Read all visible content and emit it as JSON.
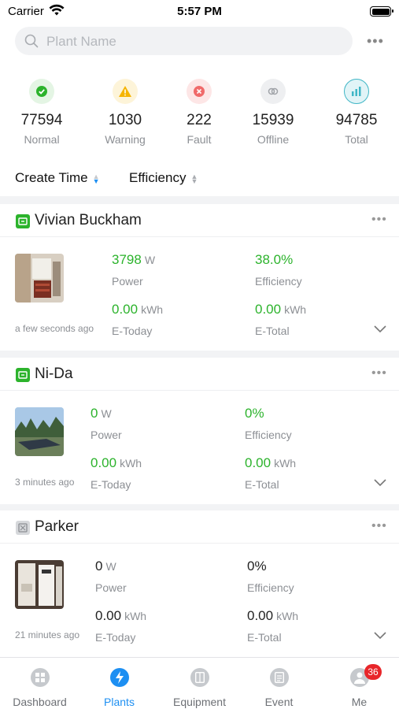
{
  "status_bar": {
    "carrier": "Carrier",
    "time": "5:57 PM"
  },
  "search": {
    "placeholder": "Plant Name"
  },
  "stats": [
    {
      "value": "77594",
      "label": "Normal",
      "icon": "check-circle-icon",
      "color": "#2cb32c"
    },
    {
      "value": "1030",
      "label": "Warning",
      "icon": "warning-triangle-icon",
      "color": "#f5b400"
    },
    {
      "value": "222",
      "label": "Fault",
      "icon": "error-x-icon",
      "color": "#f06a6a"
    },
    {
      "value": "15939",
      "label": "Offline",
      "icon": "offline-link-icon",
      "color": "#a0a3a8"
    },
    {
      "value": "94785",
      "label": "Total",
      "icon": "bar-chart-icon",
      "color": "#3fb6c6"
    }
  ],
  "sort": {
    "create_time": "Create Time",
    "efficiency": "Efficiency",
    "accent": "#1d8ff2"
  },
  "plants": [
    {
      "name": "Vivian Buckham",
      "status": "normal",
      "updated": "a few seconds ago",
      "power": "3798",
      "power_unit": "W",
      "power_label": "Power",
      "efficiency": "38.0%",
      "efficiency_label": "Efficiency",
      "e_today": "0.00",
      "e_today_unit": "kWh",
      "e_today_label": "E-Today",
      "e_total": "0.00",
      "e_total_unit": "kWh",
      "e_total_label": "E-Total"
    },
    {
      "name": "Ni-Da",
      "status": "normal",
      "updated": "3 minutes ago",
      "power": "0",
      "power_unit": "W",
      "power_label": "Power",
      "efficiency": "0%",
      "efficiency_label": "Efficiency",
      "e_today": "0.00",
      "e_today_unit": "kWh",
      "e_today_label": "E-Today",
      "e_total": "0.00",
      "e_total_unit": "kWh",
      "e_total_label": "E-Total"
    },
    {
      "name": "Parker",
      "status": "offline",
      "updated": "21 minutes ago",
      "power": "0",
      "power_unit": "W",
      "power_label": "Power",
      "efficiency": "0%",
      "efficiency_label": "Efficiency",
      "e_today": "0.00",
      "e_today_unit": "kWh",
      "e_today_label": "E-Today",
      "e_total": "0.00",
      "e_total_unit": "kWh",
      "e_total_label": "E-Total"
    }
  ],
  "tabs": [
    {
      "label": "Dashboard",
      "icon": "dashboard-icon"
    },
    {
      "label": "Plants",
      "icon": "plants-bolt-icon",
      "active": true
    },
    {
      "label": "Equipment",
      "icon": "equipment-icon"
    },
    {
      "label": "Event",
      "icon": "event-icon"
    },
    {
      "label": "Me",
      "icon": "me-avatar-icon",
      "badge": "36"
    }
  ]
}
